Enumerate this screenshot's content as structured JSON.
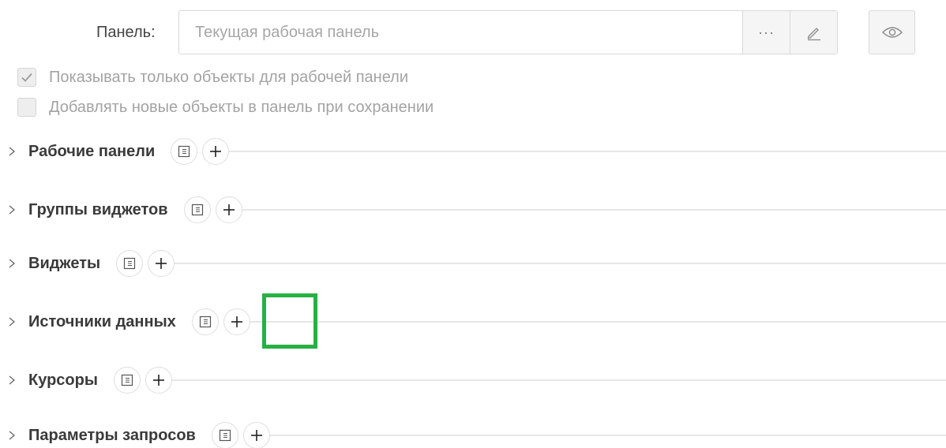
{
  "panel": {
    "label": "Панель:",
    "placeholder": "Текущая рабочая панель",
    "ellipsis": "···"
  },
  "checkboxes": [
    {
      "label": "Показывать только объекты для рабочей панели",
      "checked": true
    },
    {
      "label": "Добавлять новые объекты в панель при сохранении",
      "checked": false
    }
  ],
  "sections": [
    {
      "title": "Рабочие панели"
    },
    {
      "title": "Группы виджетов"
    },
    {
      "title": "Виджеты"
    },
    {
      "title": "Источники данных"
    },
    {
      "title": "Курсоры"
    },
    {
      "title": "Параметры запросов"
    }
  ],
  "colors": {
    "highlight": "#27b043",
    "text_primary": "#3a3a3a",
    "text_muted": "#a3a3a3"
  }
}
